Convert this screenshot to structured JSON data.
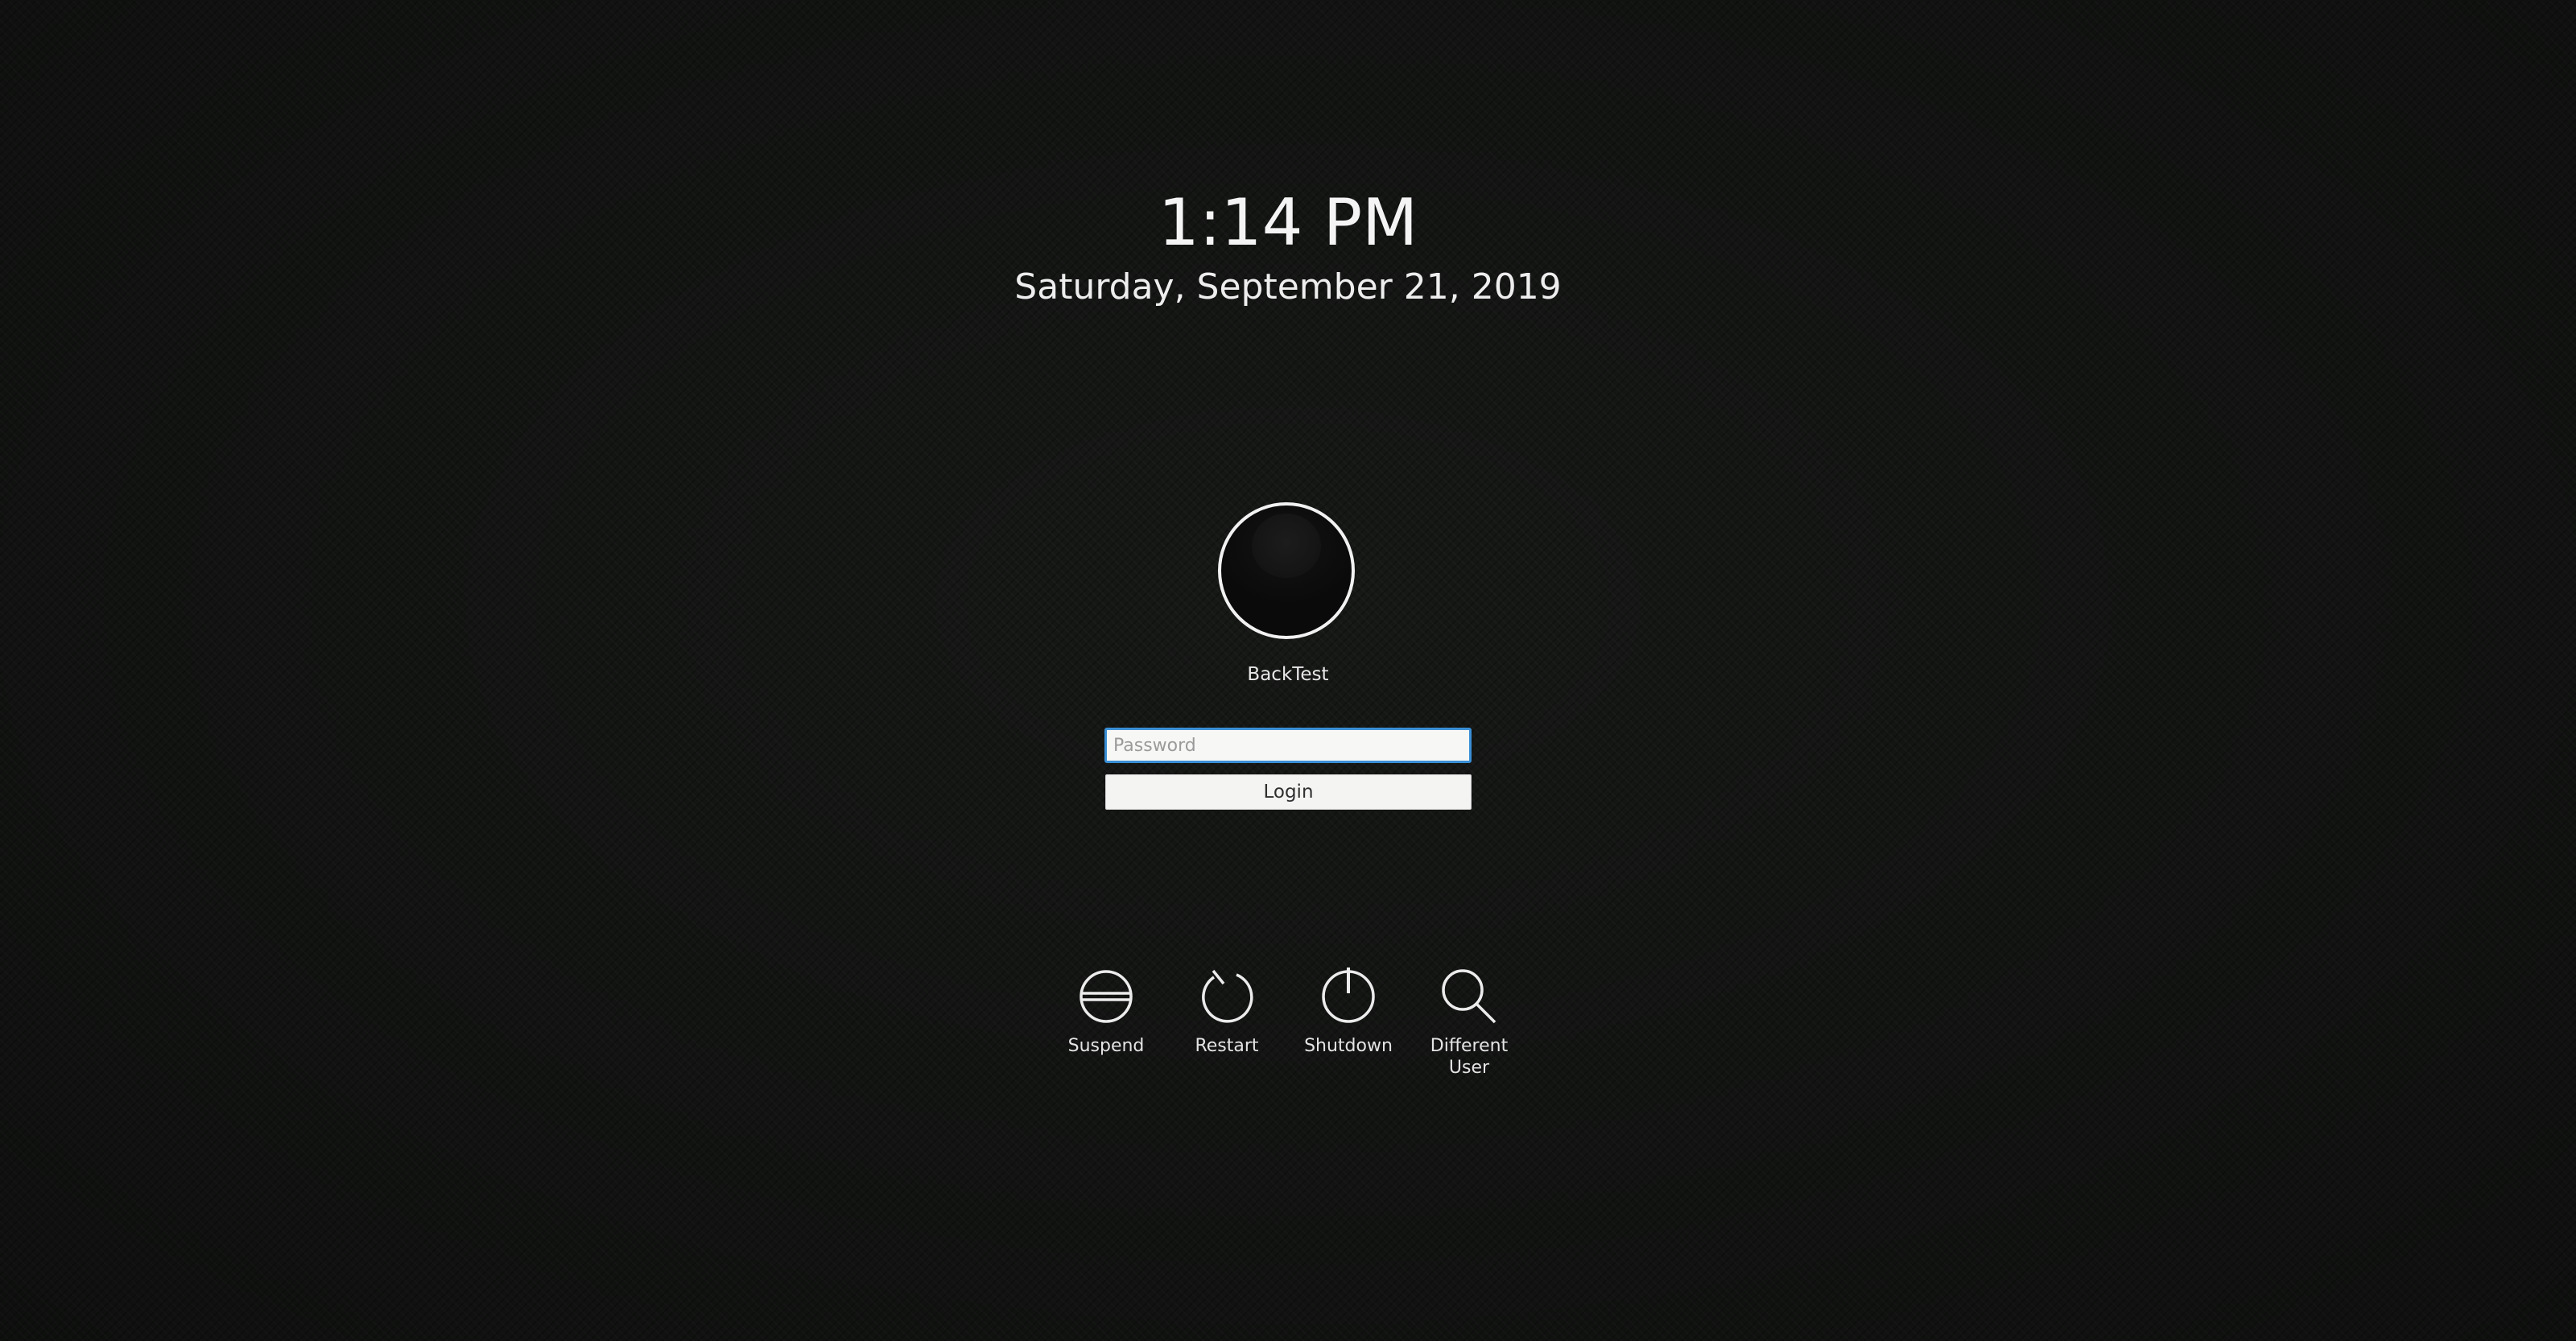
{
  "clock": {
    "time": "1:14 PM",
    "date": "Saturday, September 21, 2019"
  },
  "user": {
    "name": "BackTest",
    "avatar_icon": "user-avatar"
  },
  "login_form": {
    "password_placeholder": "Password",
    "password_value": "",
    "login_label": "Login",
    "focus_color": "#3a8fd6"
  },
  "actions": [
    {
      "label": "Suspend",
      "icon": "suspend-icon"
    },
    {
      "label": "Restart",
      "icon": "restart-icon"
    },
    {
      "label": "Shutdown",
      "icon": "power-icon"
    },
    {
      "label": "Different\nUser",
      "icon": "search-icon"
    }
  ]
}
